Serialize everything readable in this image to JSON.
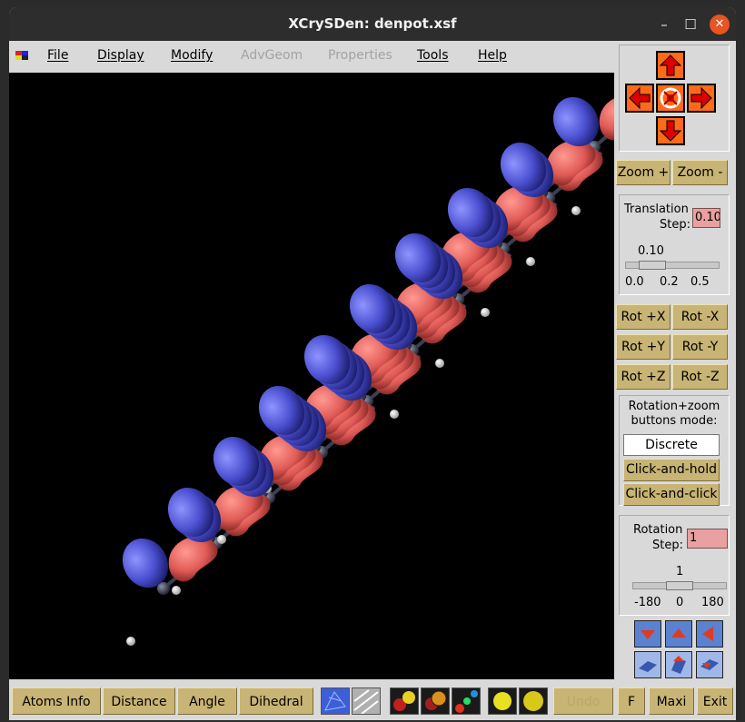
{
  "window": {
    "title": "XCrySDen: denpot.xsf",
    "minimize": "–",
    "maximize": "☐",
    "close": "✕"
  },
  "menu": [
    {
      "label": "File",
      "enabled": true
    },
    {
      "label": "Display",
      "enabled": true
    },
    {
      "label": "Modify",
      "enabled": true
    },
    {
      "label": "AdvGeom",
      "enabled": false
    },
    {
      "label": "Properties",
      "enabled": false
    },
    {
      "label": "Tools",
      "enabled": true
    },
    {
      "label": "Help",
      "enabled": true
    }
  ],
  "nav": {
    "up_icon": "arrow-up-icon",
    "down_icon": "arrow-down-icon",
    "left_icon": "arrow-left-icon",
    "right_icon": "arrow-right-icon",
    "center_icon": "reset-view-icon"
  },
  "zoom": {
    "plus": "Zoom +",
    "minus": "Zoom -"
  },
  "translation": {
    "label_line1": "Translation",
    "label_line2": "Step:",
    "value": "0.10",
    "slider_value": "0.10",
    "ticks": [
      "0.0",
      "0.2",
      "0.5"
    ],
    "fraction": 0.2
  },
  "rotate": {
    "px": "Rot +X",
    "mx": "Rot -X",
    "py": "Rot +Y",
    "my": "Rot -Y",
    "pz": "Rot +Z",
    "mz": "Rot -Z"
  },
  "mode": {
    "label_line1": "Rotation+zoom",
    "label_line2": "buttons mode:",
    "discrete": "Discrete",
    "hold": "Click-and-hold",
    "click": "Click-and-click"
  },
  "rotation": {
    "label_line1": "Rotation",
    "label_line2": "Step:",
    "value": "1",
    "slider_value": "1",
    "ticks": [
      "-180",
      "0",
      "180"
    ],
    "fraction": 0.5
  },
  "bottom": {
    "atoms_info": "Atoms Info",
    "distance": "Distance",
    "angle": "Angle",
    "dihedral": "Dihedral",
    "undo": "Undo",
    "f": "F",
    "maxi": "Maxi",
    "exit": "Exit"
  },
  "colors": {
    "lobe_red": "#e05a55",
    "lobe_blue": "#4a4fd0",
    "carbon": "#3b3f52",
    "hydrogen": "#f0f0f0",
    "button": "#c8b474",
    "viewport": "#000000",
    "arrow": "#ff6a1a"
  }
}
